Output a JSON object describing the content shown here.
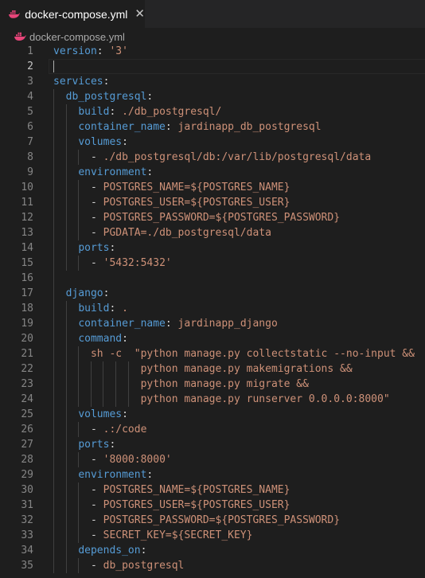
{
  "tab": {
    "label": "docker-compose.yml",
    "icon": "docker-whale-icon",
    "close_glyph": "✕"
  },
  "breadcrumb": {
    "label": "docker-compose.yml",
    "icon": "docker-whale-icon"
  },
  "colors": {
    "editor_bg": "#1e1e1e",
    "tab_bar_bg": "#252526",
    "key": "#569cd6",
    "string": "#ce9178",
    "plain": "#d4d4d4",
    "line_number": "#858585",
    "docker_icon": "#e8457a"
  },
  "editor": {
    "active_line": 2,
    "lines": [
      {
        "n": "1",
        "tokens": [
          [
            "k",
            "version"
          ],
          [
            "p",
            ": "
          ],
          [
            "s",
            "'3'"
          ]
        ]
      },
      {
        "n": "2",
        "tokens": []
      },
      {
        "n": "3",
        "tokens": [
          [
            "k",
            "services"
          ],
          [
            "p",
            ":"
          ]
        ]
      },
      {
        "n": "4",
        "tokens": [
          [
            "p",
            "  "
          ],
          [
            "k",
            "db_postgresql"
          ],
          [
            "p",
            ":"
          ]
        ]
      },
      {
        "n": "5",
        "tokens": [
          [
            "p",
            "    "
          ],
          [
            "k",
            "build"
          ],
          [
            "p",
            ": "
          ],
          [
            "s",
            "./db_postgresql/"
          ]
        ]
      },
      {
        "n": "6",
        "tokens": [
          [
            "p",
            "    "
          ],
          [
            "k",
            "container_name"
          ],
          [
            "p",
            ": "
          ],
          [
            "s",
            "jardinapp_db_postgresql"
          ]
        ]
      },
      {
        "n": "7",
        "tokens": [
          [
            "p",
            "    "
          ],
          [
            "k",
            "volumes"
          ],
          [
            "p",
            ":"
          ]
        ]
      },
      {
        "n": "8",
        "tokens": [
          [
            "p",
            "      - "
          ],
          [
            "s",
            "./db_postgresql/db:/var/lib/postgresql/data"
          ]
        ]
      },
      {
        "n": "9",
        "tokens": [
          [
            "p",
            "    "
          ],
          [
            "k",
            "environment"
          ],
          [
            "p",
            ":"
          ]
        ]
      },
      {
        "n": "10",
        "tokens": [
          [
            "p",
            "      - "
          ],
          [
            "s",
            "POSTGRES_NAME=${POSTGRES_NAME}"
          ]
        ]
      },
      {
        "n": "11",
        "tokens": [
          [
            "p",
            "      - "
          ],
          [
            "s",
            "POSTGRES_USER=${POSTGRES_USER}"
          ]
        ]
      },
      {
        "n": "12",
        "tokens": [
          [
            "p",
            "      - "
          ],
          [
            "s",
            "POSTGRES_PASSWORD=${POSTGRES_PASSWORD}"
          ]
        ]
      },
      {
        "n": "13",
        "tokens": [
          [
            "p",
            "      - "
          ],
          [
            "s",
            "PGDATA=./db_postgresql/data"
          ]
        ]
      },
      {
        "n": "14",
        "tokens": [
          [
            "p",
            "    "
          ],
          [
            "k",
            "ports"
          ],
          [
            "p",
            ":"
          ]
        ]
      },
      {
        "n": "15",
        "tokens": [
          [
            "p",
            "      - "
          ],
          [
            "s",
            "'5432:5432'"
          ]
        ]
      },
      {
        "n": "16",
        "tokens": []
      },
      {
        "n": "17",
        "tokens": [
          [
            "p",
            "  "
          ],
          [
            "k",
            "django"
          ],
          [
            "p",
            ":"
          ]
        ]
      },
      {
        "n": "18",
        "tokens": [
          [
            "p",
            "    "
          ],
          [
            "k",
            "build"
          ],
          [
            "p",
            ": "
          ],
          [
            "s",
            "."
          ]
        ]
      },
      {
        "n": "19",
        "tokens": [
          [
            "p",
            "    "
          ],
          [
            "k",
            "container_name"
          ],
          [
            "p",
            ": "
          ],
          [
            "s",
            "jardinapp_django"
          ]
        ]
      },
      {
        "n": "20",
        "tokens": [
          [
            "p",
            "    "
          ],
          [
            "k",
            "command"
          ],
          [
            "p",
            ":"
          ]
        ]
      },
      {
        "n": "21",
        "tokens": [
          [
            "p",
            "      "
          ],
          [
            "s",
            "sh -c  \"python manage.py collectstatic --no-input &&"
          ]
        ]
      },
      {
        "n": "22",
        "tokens": [
          [
            "p",
            "              "
          ],
          [
            "s",
            "python manage.py makemigrations &&"
          ]
        ]
      },
      {
        "n": "23",
        "tokens": [
          [
            "p",
            "              "
          ],
          [
            "s",
            "python manage.py migrate &&"
          ]
        ]
      },
      {
        "n": "24",
        "tokens": [
          [
            "p",
            "              "
          ],
          [
            "s",
            "python manage.py runserver 0.0.0.0:8000\""
          ]
        ]
      },
      {
        "n": "25",
        "tokens": [
          [
            "p",
            "    "
          ],
          [
            "k",
            "volumes"
          ],
          [
            "p",
            ":"
          ]
        ]
      },
      {
        "n": "26",
        "tokens": [
          [
            "p",
            "      - "
          ],
          [
            "s",
            ".:/code"
          ]
        ]
      },
      {
        "n": "27",
        "tokens": [
          [
            "p",
            "    "
          ],
          [
            "k",
            "ports"
          ],
          [
            "p",
            ":"
          ]
        ]
      },
      {
        "n": "28",
        "tokens": [
          [
            "p",
            "      - "
          ],
          [
            "s",
            "'8000:8000'"
          ]
        ]
      },
      {
        "n": "29",
        "tokens": [
          [
            "p",
            "    "
          ],
          [
            "k",
            "environment"
          ],
          [
            "p",
            ":"
          ]
        ]
      },
      {
        "n": "30",
        "tokens": [
          [
            "p",
            "      - "
          ],
          [
            "s",
            "POSTGRES_NAME=${POSTGRES_NAME}"
          ]
        ]
      },
      {
        "n": "31",
        "tokens": [
          [
            "p",
            "      - "
          ],
          [
            "s",
            "POSTGRES_USER=${POSTGRES_USER}"
          ]
        ]
      },
      {
        "n": "32",
        "tokens": [
          [
            "p",
            "      - "
          ],
          [
            "s",
            "POSTGRES_PASSWORD=${POSTGRES_PASSWORD}"
          ]
        ]
      },
      {
        "n": "33",
        "tokens": [
          [
            "p",
            "      - "
          ],
          [
            "s",
            "SECRET_KEY=${SECRET_KEY}"
          ]
        ]
      },
      {
        "n": "34",
        "tokens": [
          [
            "p",
            "    "
          ],
          [
            "k",
            "depends_on"
          ],
          [
            "p",
            ":"
          ]
        ]
      },
      {
        "n": "35",
        "tokens": [
          [
            "p",
            "      - "
          ],
          [
            "s",
            "db_postgresql"
          ]
        ]
      }
    ]
  }
}
